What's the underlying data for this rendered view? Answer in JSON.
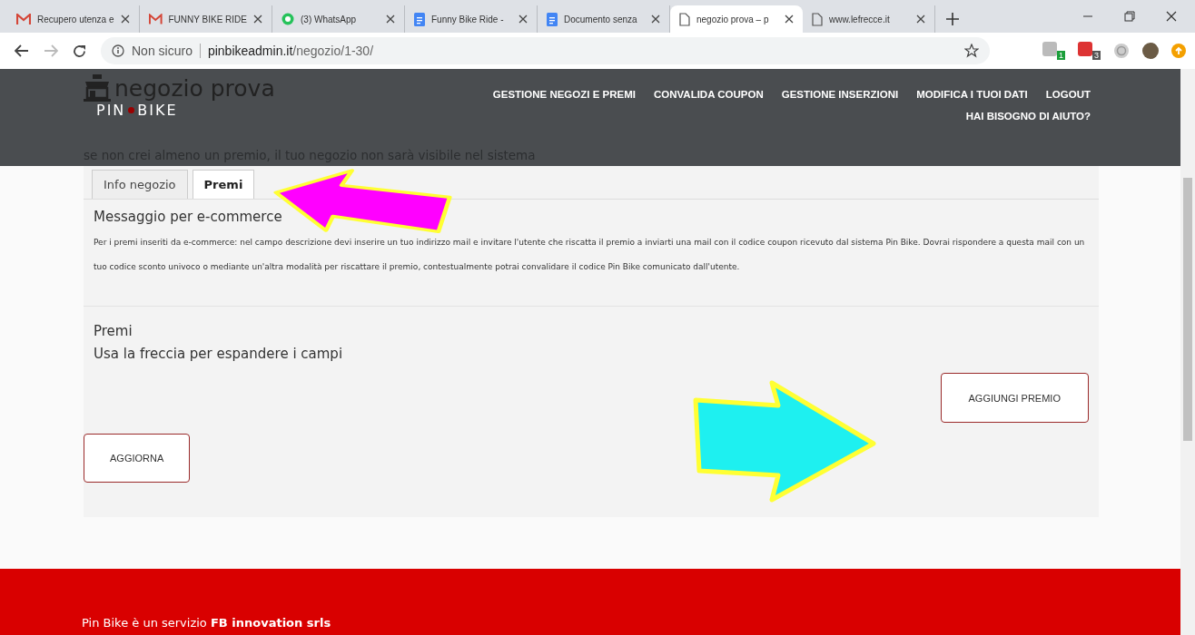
{
  "browser": {
    "tabs": [
      {
        "title": "Recupero utenza e",
        "kind": "mail",
        "selected": false
      },
      {
        "title": "FUNNY BIKE RIDE",
        "kind": "mail",
        "selected": false
      },
      {
        "title": "(3) WhatsApp",
        "kind": "chat",
        "selected": false
      },
      {
        "title": "Funny Bike Ride -",
        "kind": "doc",
        "selected": false
      },
      {
        "title": "Documento senza",
        "kind": "doc",
        "selected": false
      },
      {
        "title": "negozio prova – p",
        "kind": "page",
        "selected": true
      },
      {
        "title": "www.lefrecce.it",
        "kind": "page",
        "selected": false
      }
    ],
    "address": {
      "security": "Non sicuro",
      "host": "pinbikeadmin.it",
      "path": "/negozio/1-30/"
    },
    "extension_badges": [
      "1",
      "3"
    ]
  },
  "header": {
    "shop_name": "negozio prova",
    "logo_left": "PIN",
    "logo_right": "BIKE",
    "nav": [
      "GESTIONE NEGOZI E PREMI",
      "CONVALIDA COUPON",
      "GESTIONE INSERZIONI",
      "MODIFICA I TUOI DATI",
      "LOGOUT"
    ],
    "help": "HAI BISOGNO DI AIUTO?",
    "warning": "se non crei almeno un premio, il tuo negozio non sarà visibile nel sistema"
  },
  "tabs": [
    {
      "label": "Info negozio",
      "selected": false
    },
    {
      "label": "Premi",
      "selected": true
    }
  ],
  "ecommerce": {
    "title": "Messaggio per e-commerce",
    "text": "Per i premi inseriti da e-commerce: nel campo descrizione devi inserire un tuo indirizzo mail e invitare l'utente che riscatta il premio a inviarti una mail con il codice coupon ricevuto dal sistema Pin Bike. Dovrai rispondere a questa mail con un tuo codice sconto univoco o mediante un'altra modalità per riscattare il premio, contestualmente potrai convalidare il codice Pin Bike comunicato dall'utente."
  },
  "prizes": {
    "title": "Premi",
    "hint": "Usa la freccia per espandere i campi",
    "add_button": "AGGIUNGI PREMIO"
  },
  "update_button": "AGGIORNA",
  "footer": "Pin Bike è un servizio **FB innovation srls**"
}
